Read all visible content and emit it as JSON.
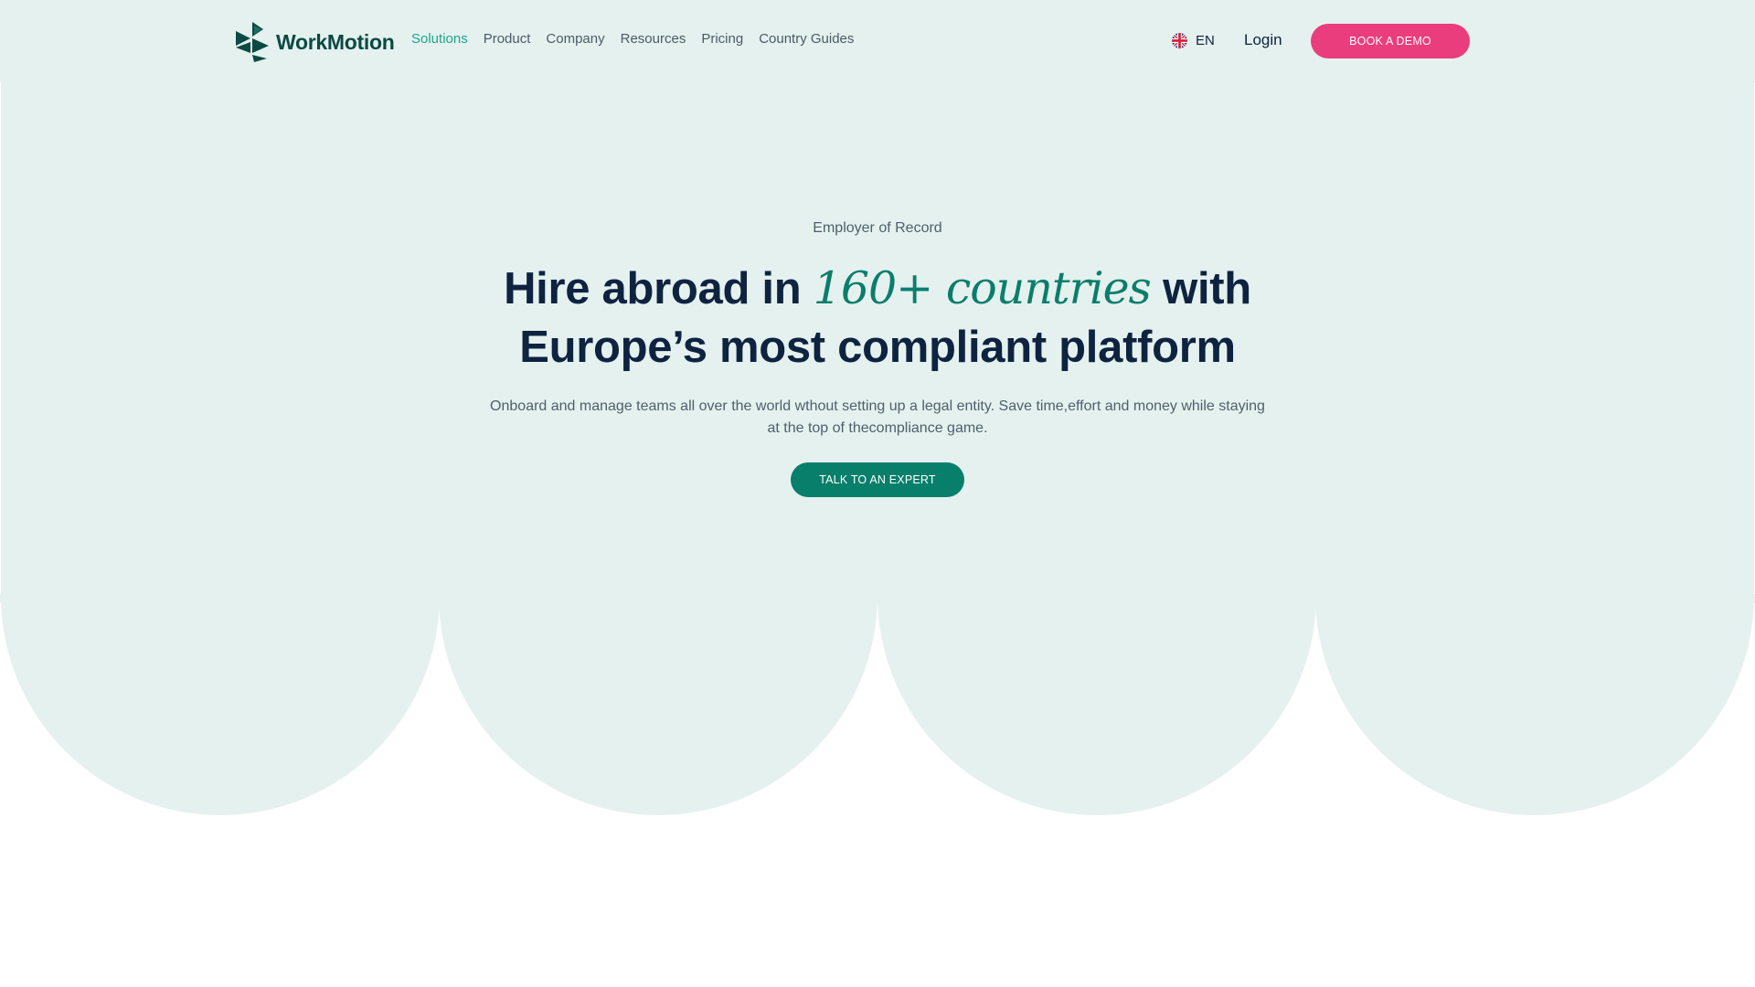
{
  "brand": {
    "name": "WorkMotion"
  },
  "nav": {
    "items": [
      {
        "label": "Solutions",
        "active": true
      },
      {
        "label": "Product",
        "active": false
      },
      {
        "label": "Company",
        "active": false
      },
      {
        "label": "Resources",
        "active": false
      },
      {
        "label": "Pricing",
        "active": false
      },
      {
        "label": "Country Guides",
        "active": false
      }
    ]
  },
  "header": {
    "language": {
      "code": "EN",
      "icon": "uk-flag-icon"
    },
    "login_label": "Login",
    "demo_label": "BOOK A DEMO"
  },
  "hero": {
    "eyebrow": "Employer of Record",
    "headline_part1": "Hire abroad in ",
    "headline_accent": "160+ countries",
    "headline_part2": " with",
    "headline_line2": "Europe’s most compliant platform",
    "subtext": "Onboard and manage teams all over the world wthout setting up a legal entity. Save time,effort and money while staying at the top of thecompliance game.",
    "cta_label": "TALK TO AN EXPERT"
  },
  "colors": {
    "hero_background": "#e5f1ee",
    "navy": "#0e2340",
    "brand_green": "#0a4a43",
    "accent_green": "#077f6b",
    "nav_active": "#1aa88e",
    "demo_pink": "#ea3d7d"
  }
}
